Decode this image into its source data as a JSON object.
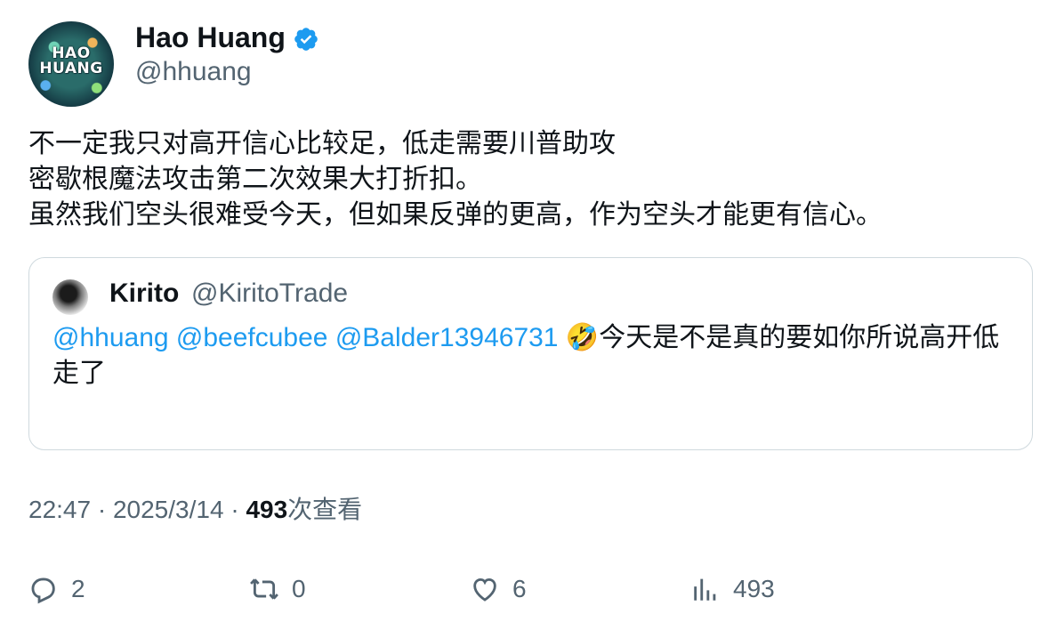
{
  "author": {
    "name": "Hao Huang",
    "handle": "@hhuang",
    "avatar_text": "HAO HUANG",
    "verified": true
  },
  "tweet": {
    "lines": [
      "不一定我只对高开信心比较足，低走需要川普助攻",
      "密歇根魔法攻击第二次效果大打折扣。",
      "虽然我们空头很难受今天，但如果反弹的更高，作为空头才能更有信心。"
    ]
  },
  "quoted": {
    "name": "Kirito",
    "handle": "@KiritoTrade",
    "mentions": [
      "@hhuang",
      "@beefcubee",
      "@Balder13946731"
    ],
    "emoji": "🤣",
    "text": "今天是不是真的要如你所说高开低走了"
  },
  "meta": {
    "time": "22:47",
    "date": "2025/3/14",
    "separator": "·",
    "views_count": "493",
    "views_label": "次查看"
  },
  "actions": {
    "replies": "2",
    "reposts": "0",
    "likes": "6",
    "views": "493"
  },
  "colors": {
    "link": "#1d9bf0",
    "muted": "#536471",
    "text": "#0f1419",
    "border": "#cfd9de"
  }
}
